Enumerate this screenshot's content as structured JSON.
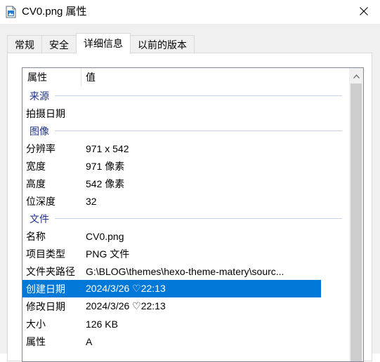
{
  "window": {
    "title": "CV0.png 属性",
    "icon": "image-file-icon",
    "close_icon": "close-icon"
  },
  "tabs": [
    {
      "label": "常规",
      "active": false
    },
    {
      "label": "安全",
      "active": false
    },
    {
      "label": "详细信息",
      "active": true
    },
    {
      "label": "以前的版本",
      "active": false
    }
  ],
  "details": {
    "columns": {
      "property": "属性",
      "value": "值"
    },
    "groups": {
      "source": "来源",
      "image": "图像",
      "file": "文件"
    },
    "rows": {
      "date_taken": {
        "property": "拍摄日期",
        "value": ""
      },
      "dimensions": {
        "property": "分辨率",
        "value": "971 x 542"
      },
      "width": {
        "property": "宽度",
        "value": "971 像素"
      },
      "height": {
        "property": "高度",
        "value": "542 像素"
      },
      "bit_depth": {
        "property": "位深度",
        "value": "32"
      },
      "name": {
        "property": "名称",
        "value": "CV0.png"
      },
      "item_type": {
        "property": "项目类型",
        "value": "PNG 文件"
      },
      "folder_path": {
        "property": "文件夹路径",
        "value": "G:\\BLOG\\themes\\hexo-theme-matery\\sourc..."
      },
      "date_created": {
        "property": "创建日期",
        "value": "2024/3/26 ♡22:13"
      },
      "date_modified": {
        "property": "修改日期",
        "value": "2024/3/26 ♡22:13"
      },
      "size": {
        "property": "大小",
        "value": "126 KB"
      },
      "attributes": {
        "property": "属性",
        "value": "A"
      }
    },
    "selected_row": "date_created",
    "selection_color": "#0078d7",
    "group_color": "#1e3287"
  }
}
